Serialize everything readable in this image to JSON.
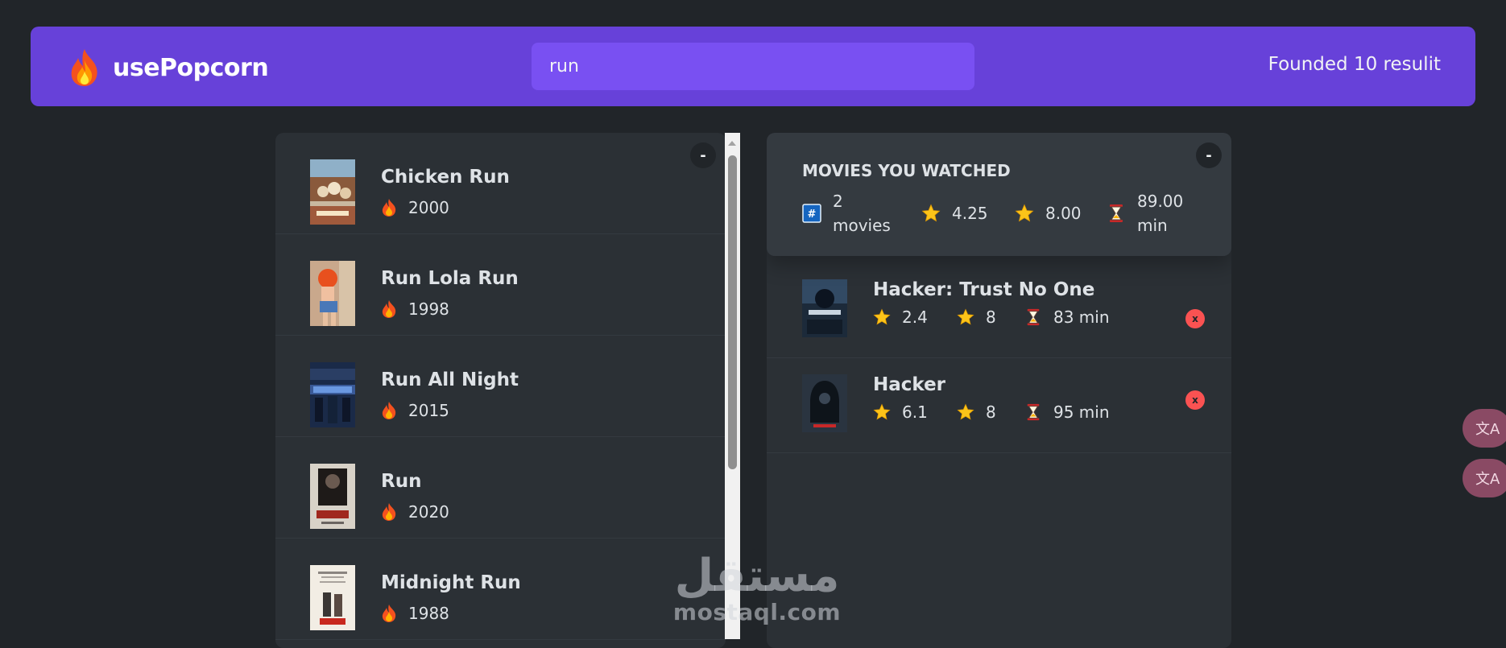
{
  "header": {
    "brand": "usePopcorn",
    "search_value": "run",
    "results_text": "Founded 10 resulit"
  },
  "toggles": {
    "left": "-",
    "right": "-"
  },
  "search_results": [
    {
      "title": "Chicken Run",
      "year": "2000"
    },
    {
      "title": "Run Lola Run",
      "year": "1998"
    },
    {
      "title": "Run All Night",
      "year": "2015"
    },
    {
      "title": "Run",
      "year": "2020"
    },
    {
      "title": "Midnight Run",
      "year": "1988"
    }
  ],
  "summary": {
    "heading": "MOVIES YOU WATCHED",
    "count_line1": "2",
    "count_line2": "movies",
    "avg_imdb": "4.25",
    "avg_user": "8.00",
    "runtime_line1": "89.00",
    "runtime_line2": "min"
  },
  "watched": [
    {
      "title": "Hacker: Trust No One",
      "imdb": "2.4",
      "user": "8",
      "runtime": "83 min",
      "delete": "x"
    },
    {
      "title": "Hacker",
      "imdb": "6.1",
      "user": "8",
      "runtime": "95 min",
      "delete": "x"
    }
  ],
  "translate_buttons": [
    "文A",
    "文A"
  ],
  "watermark": {
    "arabic": "مستقل",
    "latin": "mostaql.com"
  },
  "icons": {
    "fire": "fire-icon",
    "hash": "hash-icon",
    "star": "star-icon",
    "hourglass": "hourglass-icon",
    "translate": "translate-icon"
  },
  "colors": {
    "background": "#212529",
    "nav": "#6741d9",
    "search": "#7950f2",
    "box": "#2b3035",
    "summary": "#343a40",
    "delete": "#fa5252"
  }
}
